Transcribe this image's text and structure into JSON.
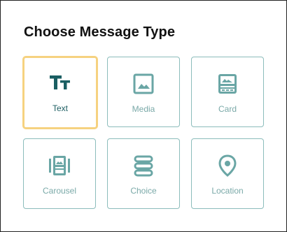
{
  "dialog": {
    "title": "Choose Message Type"
  },
  "colors": {
    "icon_selected": "#1a5e62",
    "icon": "#6aa6a5",
    "tile_border": "#8bbcbb",
    "selected_border": "#f6d280"
  },
  "types": [
    {
      "label": "Text",
      "icon": "text-format-icon",
      "selected": true
    },
    {
      "label": "Media",
      "icon": "image-icon",
      "selected": false
    },
    {
      "label": "Card",
      "icon": "card-icon",
      "selected": false
    },
    {
      "label": "Carousel",
      "icon": "carousel-icon",
      "selected": false
    },
    {
      "label": "Choice",
      "icon": "choice-list-icon",
      "selected": false
    },
    {
      "label": "Location",
      "icon": "location-pin-icon",
      "selected": false
    }
  ]
}
